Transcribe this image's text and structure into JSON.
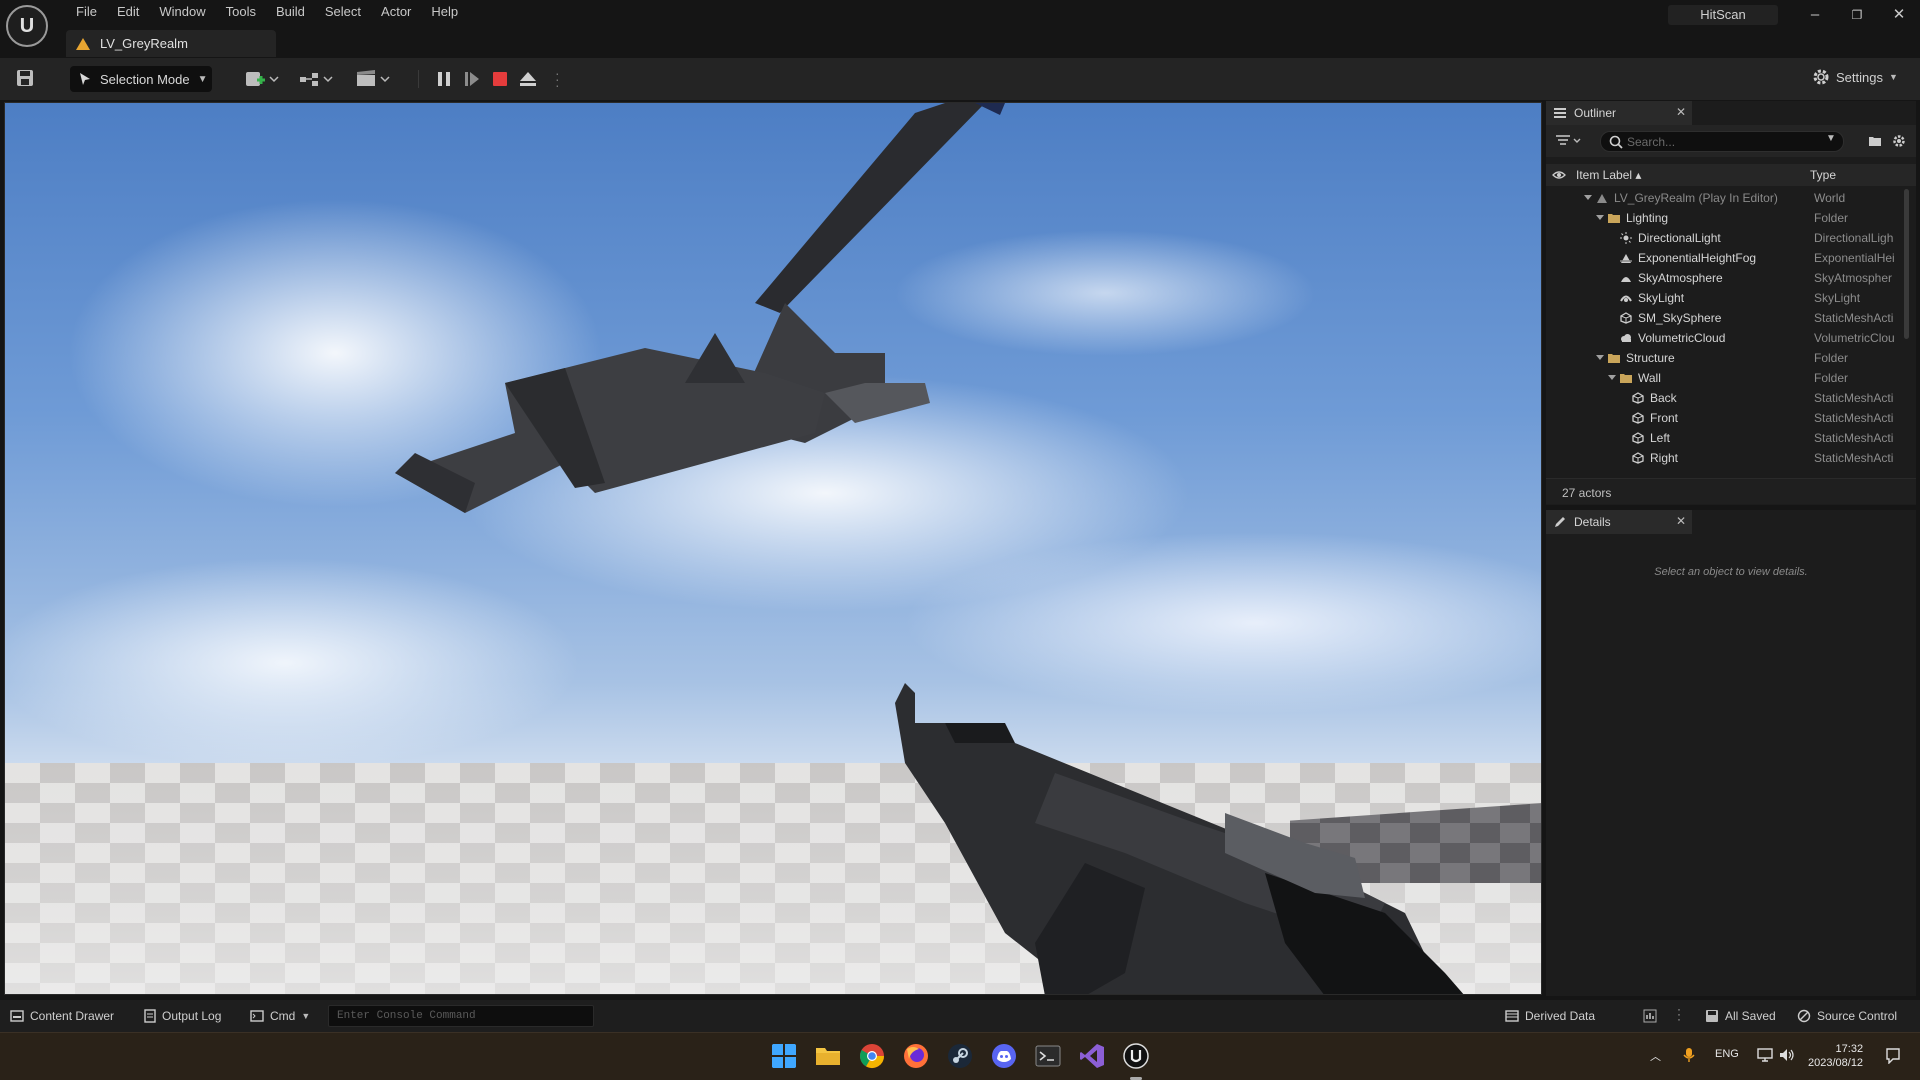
{
  "menu": [
    "File",
    "Edit",
    "Window",
    "Tools",
    "Build",
    "Select",
    "Actor",
    "Help"
  ],
  "project_name": "HitScan",
  "window_controls": {
    "minimize": "–",
    "restore": "❐",
    "close": "✕"
  },
  "level_tab": "LV_GreyRealm",
  "toolbar": {
    "selection_mode": "Selection Mode",
    "settings": "Settings"
  },
  "outliner": {
    "title": "Outliner",
    "search_placeholder": "Search...",
    "col_label": "Item Label ▴",
    "col_type": "Type",
    "rows": [
      {
        "label": "LV_GreyRealm (Play In Editor)",
        "type": "World",
        "icon": "world-icon"
      },
      {
        "label": "Lighting",
        "type": "Folder",
        "icon": "folder-icon"
      },
      {
        "label": "DirectionalLight",
        "type": "DirectionalLigh",
        "icon": "directional-light-icon"
      },
      {
        "label": "ExponentialHeightFog",
        "type": "ExponentialHei",
        "icon": "fog-icon"
      },
      {
        "label": "SkyAtmosphere",
        "type": "SkyAtmospher",
        "icon": "sky-atmosphere-icon"
      },
      {
        "label": "SkyLight",
        "type": "SkyLight",
        "icon": "skylight-icon"
      },
      {
        "label": "SM_SkySphere",
        "type": "StaticMeshActi",
        "icon": "static-mesh-icon"
      },
      {
        "label": "VolumetricCloud",
        "type": "VolumetricClou",
        "icon": "cloud-icon"
      },
      {
        "label": "Structure",
        "type": "Folder",
        "icon": "folder-icon"
      },
      {
        "label": "Wall",
        "type": "Folder",
        "icon": "folder-icon"
      },
      {
        "label": "Back",
        "type": "StaticMeshActi",
        "icon": "static-mesh-icon"
      },
      {
        "label": "Front",
        "type": "StaticMeshActi",
        "icon": "static-mesh-icon"
      },
      {
        "label": "Left",
        "type": "StaticMeshActi",
        "icon": "static-mesh-icon"
      },
      {
        "label": "Right",
        "type": "StaticMeshActi",
        "icon": "static-mesh-icon"
      }
    ],
    "actor_count": "27 actors"
  },
  "details": {
    "title": "Details",
    "hint": "Select an object to view details."
  },
  "statusbar": {
    "content_drawer": "Content Drawer",
    "output_log": "Output Log",
    "cmd": "Cmd",
    "console_placeholder": "Enter Console Command",
    "derived_data": "Derived Data",
    "all_saved": "All Saved",
    "source_control": "Source Control"
  },
  "taskbar": {
    "language": "ENG",
    "time": "17:32",
    "date": "2023/08/12"
  },
  "colors": {
    "accent": "#e8a531",
    "stop_red": "#e53c3c",
    "viewport_sky": "#6f9bd6"
  }
}
